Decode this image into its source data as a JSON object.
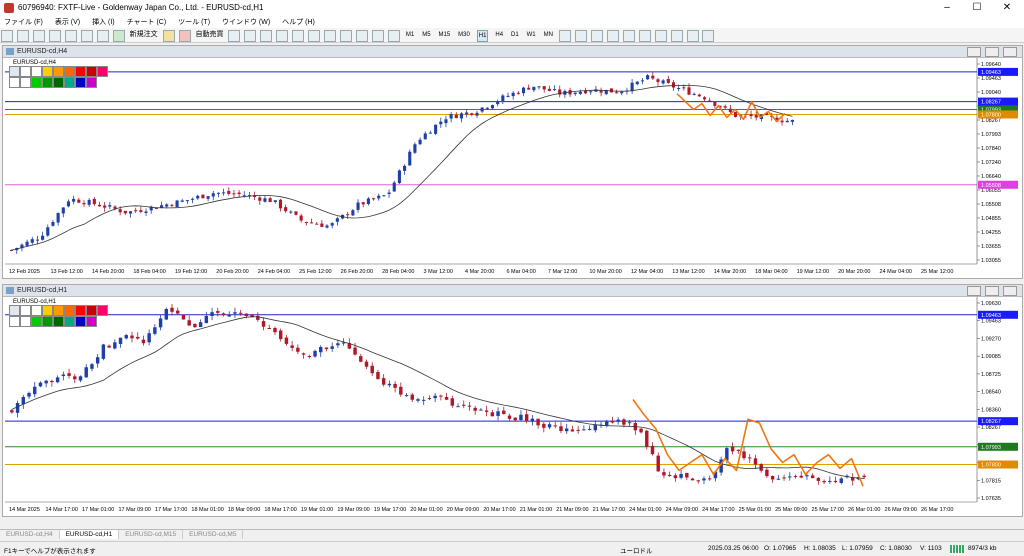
{
  "window": {
    "title": "60796940: FXTF-Live - Goldenway Japan Co., Ltd. - EURUSD-cd,H1"
  },
  "menu": [
    "ファイル (F)",
    "表示 (V)",
    "挿入 (I)",
    "チャート (C)",
    "ツール (T)",
    "ウインドウ (W)",
    "ヘルプ (H)"
  ],
  "toolbar": {
    "new_order": "新規注文",
    "auto_trade": "自動売買",
    "timeframes": [
      "M1",
      "M5",
      "M15",
      "M30",
      "H1",
      "H4",
      "D1",
      "W1",
      "MN"
    ],
    "selected_timeframe": "H1"
  },
  "charts": [
    {
      "title": "EURUSD-cd,H4",
      "symbol": "EURUSD-cd,H4",
      "price_labels": [
        "1.09640",
        "1.09463",
        "1.09040",
        "1.08440",
        "1.08267",
        "1.07993",
        "1.07840",
        "1.07240",
        "1.06640",
        "1.06055",
        "1.05508",
        "1.04855",
        "1.04255",
        "1.03655",
        "1.03055"
      ],
      "time_labels": [
        "12 Feb 2025",
        "13 Feb 12:00",
        "14 Feb 20:00",
        "18 Feb 04:00",
        "19 Feb 12:00",
        "20 Feb 20:00",
        "24 Feb 04:00",
        "25 Feb 12:00",
        "26 Feb 20:00",
        "28 Feb 04:00",
        "3 Mar 12:00",
        "4 Mar 20:00",
        "6 Mar 04:00",
        "7 Mar 12:00",
        "10 Mar 20:00",
        "12 Mar 04:00",
        "13 Mar 12:00",
        "14 Mar 20:00",
        "18 Mar 04:00",
        "19 Mar 12:00",
        "20 Mar 20:00",
        "24 Mar 04:00",
        "25 Mar 12:00"
      ],
      "highlight_labels": [
        {
          "text": "1.09463",
          "color": "#1a1aff"
        },
        {
          "text": "1.08267",
          "color": "#1a1aff"
        },
        {
          "text": "1.07993",
          "color": "#1f7a1f"
        },
        {
          "text": "1.07800",
          "color": "#e08a00"
        },
        {
          "text": "1.05508",
          "color": "#e040e0"
        }
      ]
    },
    {
      "title": "EURUSD-cd,H1",
      "symbol": "EURUSD-cd,H1",
      "price_labels": [
        "1.09630",
        "1.09463",
        "1.09270",
        "1.09085",
        "1.08725",
        "1.08540",
        "1.08360",
        "1.08267",
        "1.08180",
        "1.07993",
        "1.07815",
        "1.07635"
      ],
      "time_labels": [
        "14 Mar 2025",
        "14 Mar 17:00",
        "17 Mar 01:00",
        "17 Mar 09:00",
        "17 Mar 17:00",
        "18 Mar 01:00",
        "18 Mar 09:00",
        "18 Mar 17:00",
        "19 Mar 01:00",
        "19 Mar 09:00",
        "19 Mar 17:00",
        "20 Mar 01:00",
        "20 Mar 09:00",
        "20 Mar 17:00",
        "21 Mar 01:00",
        "21 Mar 09:00",
        "21 Mar 17:00",
        "24 Mar 01:00",
        "24 Mar 09:00",
        "24 Mar 17:00",
        "25 Mar 01:00",
        "25 Mar 09:00",
        "25 Mar 17:00",
        "26 Mar 01:00",
        "26 Mar 09:00",
        "26 Mar 17:00"
      ],
      "highlight_labels": [
        {
          "text": "1.09463",
          "color": "#1a1aff"
        },
        {
          "text": "1.08267",
          "color": "#1a1aff"
        },
        {
          "text": "1.07993",
          "color": "#1f7a1f"
        },
        {
          "text": "1.07800",
          "color": "#e08a00"
        }
      ]
    }
  ],
  "colors": {
    "bull": "#1f3fa8",
    "bear": "#b0182a",
    "ma": "#333333",
    "resistance": "#2222cc",
    "green_line": "#2a8a2a",
    "orange_line": "#e0a000",
    "pink_line": "#e060e0",
    "wave": "#ee7711"
  },
  "palette_colors": [
    "#ffcc00",
    "#ff9900",
    "#ff6600",
    "#ff0000",
    "#cc0000",
    "#ff0066",
    "#00cc00",
    "#009900",
    "#006600",
    "#00aa88",
    "#0000cc",
    "#cc00cc"
  ],
  "tabs": [
    "EURUSD-cd,H4",
    "EURUSD-cd,H1",
    "EURUSD-cd,M15",
    "EURUSD-cd,M5"
  ],
  "active_tab": "EURUSD-cd,H1",
  "status": {
    "help": "F1キーでヘルプが表示されます",
    "profile": "ユーロドル",
    "time": "2025.03.25 06:00",
    "open": "O: 1.07965",
    "high": "H: 1.08035",
    "low": "L: 1.07959",
    "close": "C: 1.08030",
    "volume": "V: 1103",
    "traffic": "8974/3 kb"
  }
}
